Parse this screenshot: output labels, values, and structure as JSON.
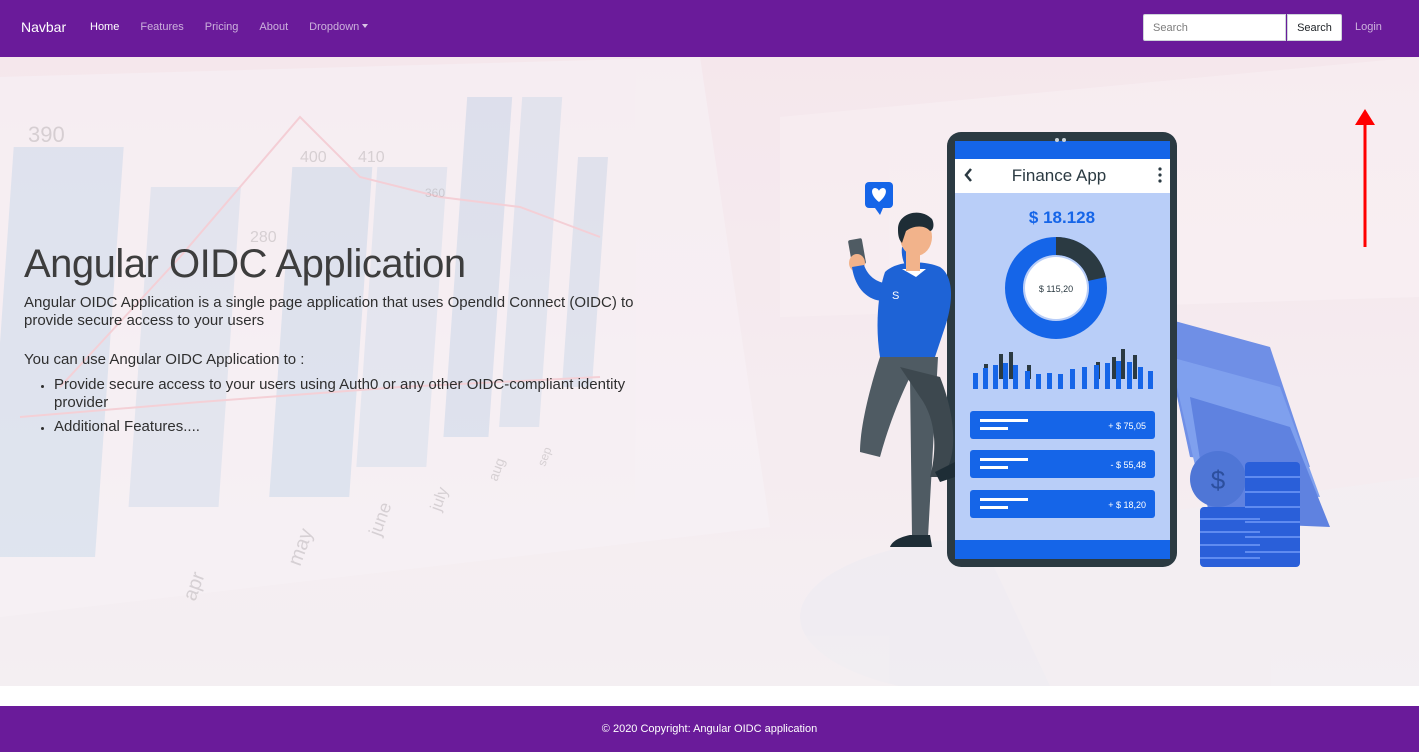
{
  "navbar": {
    "brand": "Navbar",
    "links": [
      {
        "label": "Home",
        "active": true
      },
      {
        "label": "Features",
        "active": false
      },
      {
        "label": "Pricing",
        "active": false
      },
      {
        "label": "About",
        "active": false
      },
      {
        "label": "Dropdown",
        "active": false,
        "has_caret": true
      }
    ],
    "search_placeholder": "Search",
    "search_button": "Search",
    "login": "Login",
    "color": "#6a1b9a"
  },
  "hero": {
    "title": "Angular OIDC Application",
    "description": "Angular OIDC Application is a single page application that uses OpendId Connect (OIDC) to provide secure access to your users",
    "subheading": "You can use Angular OIDC Application to :",
    "features": [
      "Provide secure access to your users using Auth0 or any other OIDC-compliant identity provider",
      "Additional Features...."
    ],
    "background_chart_labels": [
      "390",
      "400",
      "410",
      "280",
      "360",
      "apr",
      "may",
      "june",
      "july",
      "aug",
      "sep"
    ]
  },
  "illustration": {
    "app_title": "Finance App",
    "balance": "$ 18.128",
    "donut_value": "$ 115,20",
    "transactions": [
      "+ $ 75,05",
      "- $ 55,48",
      "+ $ 18,20"
    ],
    "shirt_letter": "S",
    "icons": [
      "heart-chat-icon",
      "dollar-coin-icon",
      "back-arrow-icon",
      "more-vertical-icon"
    ]
  },
  "annotation": {
    "arrow_color": "#ff0000",
    "points_to": "Login"
  },
  "footer": {
    "copyright": "© 2020 Copyright: Angular OIDC application"
  }
}
